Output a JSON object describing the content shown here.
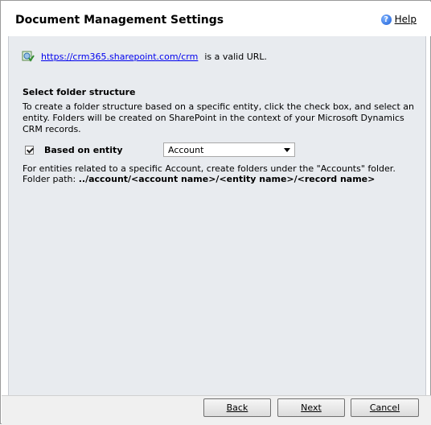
{
  "dialog": {
    "title": "Document Management Settings",
    "help": {
      "label": "Help"
    }
  },
  "status": {
    "url": "https://crm365.sharepoint.com/crm",
    "suffix": "is a valid URL."
  },
  "folder_structure": {
    "heading": "Select folder structure",
    "description": "To create a folder structure based on a specific entity, click the check box, and select an entity. Folders will be created on SharePoint in the context of your Microsoft Dynamics CRM records.",
    "checkbox_label": "Based on entity",
    "checkbox_checked": true,
    "entity_selected": "Account",
    "info_line": "For entities related to a specific Account, create folders under the \"Accounts\" folder.",
    "path_prefix": "Folder path:",
    "path_value": "../account/<account name>/<entity name>/<record name>"
  },
  "buttons": {
    "back": "Back",
    "next": "Next",
    "cancel": "Cancel"
  },
  "icons": {
    "help": "help-icon",
    "url_status": "globe-check-icon",
    "dropdown": "chevron-down-icon"
  },
  "colors": {
    "link": "#0000ee",
    "content_bg": "#e8ebef"
  }
}
